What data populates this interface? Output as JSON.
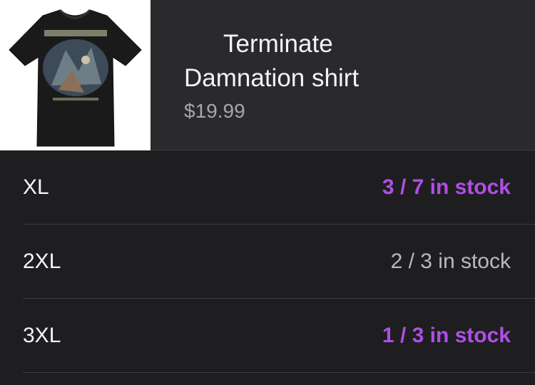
{
  "product": {
    "title": "Terminate Damnation shirt",
    "price": "$19.99",
    "image_icon": "t-shirt-image"
  },
  "variants": [
    {
      "size": "XL",
      "stock": "3 / 7 in stock",
      "highlighted": true
    },
    {
      "size": "2XL",
      "stock": "2 / 3 in stock",
      "highlighted": false
    },
    {
      "size": "3XL",
      "stock": "1 / 3 in stock",
      "highlighted": true
    }
  ],
  "colors": {
    "highlight": "#b04ee8",
    "muted": "#b9b9bd",
    "background": "#1e1e20",
    "header_background": "#2a2a2d"
  }
}
